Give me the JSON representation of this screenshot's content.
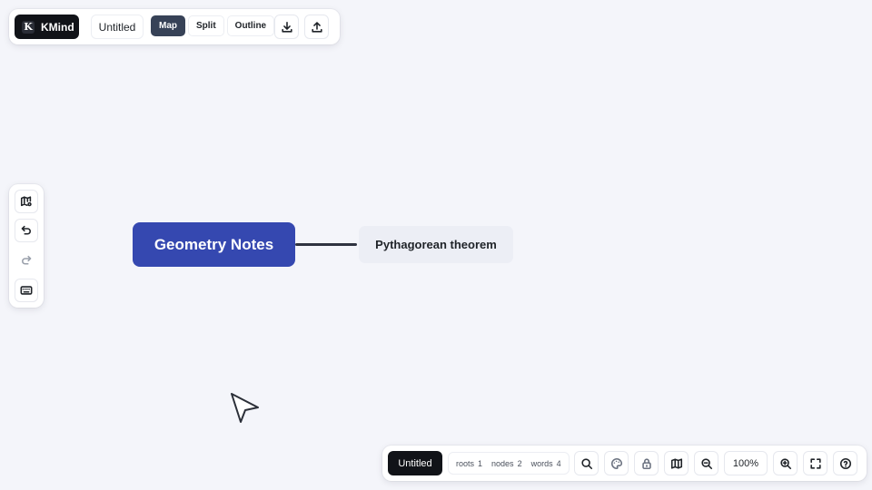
{
  "app": {
    "brand_letter": "K",
    "brand_name": "KMind"
  },
  "header": {
    "doc_title": "Untitled",
    "views": [
      {
        "label": "Map",
        "active": true
      },
      {
        "label": "Split",
        "active": false
      },
      {
        "label": "Outline",
        "active": false
      }
    ],
    "actions": [
      "download-icon",
      "upload-icon"
    ]
  },
  "sidebar": {
    "tools": [
      "map-settings-icon",
      "undo-icon",
      "redo-icon",
      "keyboard-icon"
    ]
  },
  "mindmap": {
    "root": {
      "label": "Geometry Notes",
      "color": "#3548b0"
    },
    "children": [
      {
        "label": "Pythagorean theorem"
      }
    ]
  },
  "footer": {
    "doc_title": "Untitled",
    "stats": [
      {
        "label": "roots",
        "value": "1"
      },
      {
        "label": "nodes",
        "value": "2"
      },
      {
        "label": "words",
        "value": "4"
      }
    ],
    "zoom": "100%",
    "tools": [
      "search-icon",
      "theme-icon",
      "lock-icon",
      "minimap-icon",
      "zoom-out-icon",
      "zoom-in-icon",
      "fullscreen-icon",
      "help-icon"
    ]
  }
}
